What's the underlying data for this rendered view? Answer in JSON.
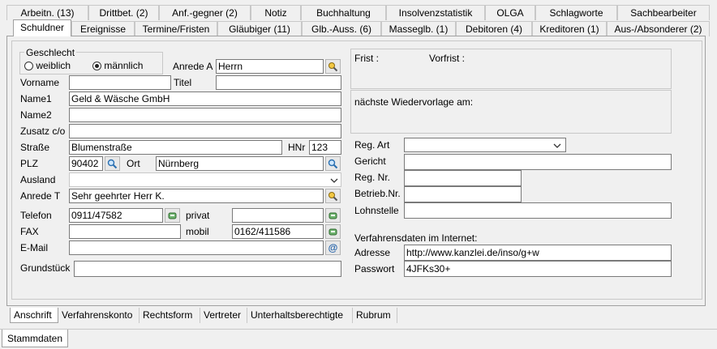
{
  "top_tabs_row1": [
    "Arbeitn. (13)",
    "Drittbet. (2)",
    "Anf.-gegner (2)",
    "Notiz",
    "Buchhaltung",
    "Insolvenzstatistik",
    "OLGA",
    "Schlagworte",
    "Sachbearbeiter"
  ],
  "top_tabs_row2": [
    "Schuldner",
    "Ereignisse",
    "Termine/Fristen",
    "Gläubiger (11)",
    "Glb.-Auss. (6)",
    "Masseglb. (1)",
    "Debitoren (4)",
    "Kreditoren (1)",
    "Aus-/Absonderer (2)"
  ],
  "active_top_tab": "Schuldner",
  "gender": {
    "legend": "Geschlecht",
    "option_female": "weiblich",
    "option_male": "männlich",
    "selected": "männlich"
  },
  "form": {
    "anrede_a_label": "Anrede A",
    "anrede_a_value": "Herrn",
    "vorname_label": "Vorname",
    "vorname_value": "",
    "titel_label": "Titel",
    "titel_value": "",
    "name1_label": "Name1",
    "name1_value": "Geld & Wäsche GmbH",
    "name2_label": "Name2",
    "name2_value": "",
    "zusatz_label": "Zusatz c/o",
    "zusatz_value": "",
    "strasse_label": "Straße",
    "strasse_value": "Blumenstraße",
    "hnr_label": "HNr",
    "hnr_value": "123",
    "plz_label": "PLZ",
    "plz_value": "90402",
    "ort_label": "Ort",
    "ort_value": "Nürnberg",
    "ausland_label": "Ausland",
    "ausland_value": "",
    "anrede_t_label": "Anrede T",
    "anrede_t_value": "Sehr geehrter Herr K.",
    "telefon_label": "Telefon",
    "telefon_value": "0911/47582",
    "privat_label": "privat",
    "privat_value": "",
    "fax_label": "FAX",
    "fax_value": "",
    "mobil_label": "mobil",
    "mobil_value": "0162/411586",
    "email_label": "E-Mail",
    "email_value": "",
    "grundstueck_label": "Grundstück",
    "grundstueck_value": ""
  },
  "right": {
    "frist_label": "Frist :",
    "vorfrist_label": "Vorfrist :",
    "wiedervorlage_label": "nächste Wiedervorlage am:",
    "reg_art_label": "Reg. Art",
    "reg_art_value": "",
    "gericht_label": "Gericht",
    "gericht_value": "",
    "reg_nr_label": "Reg. Nr.",
    "reg_nr_value": "",
    "betrieb_nr_label": "Betrieb.Nr.",
    "betrieb_nr_value": "",
    "lohnstelle_label": "Lohnstelle",
    "lohnstelle_value": "",
    "internet_heading": "Verfahrensdaten im Internet:",
    "adresse_label": "Adresse",
    "adresse_value": "http://www.kanzlei.de/inso/g+w",
    "passwort_label": "Passwort",
    "passwort_value": "4JFKs30+"
  },
  "bottom_tabs": [
    "Anschrift",
    "Verfahrenskonto",
    "Rechtsform",
    "Vertreter",
    "Unterhaltsberechtigte",
    "Rubrum"
  ],
  "active_bottom_tab": "Anschrift",
  "footer_tab": "Stammdaten",
  "icons": {
    "lookup": "key-search-icon",
    "search": "magnifier-icon",
    "phone": "phone-icon",
    "email": "at-sign-icon",
    "dropdown": "chevron-down-icon"
  }
}
